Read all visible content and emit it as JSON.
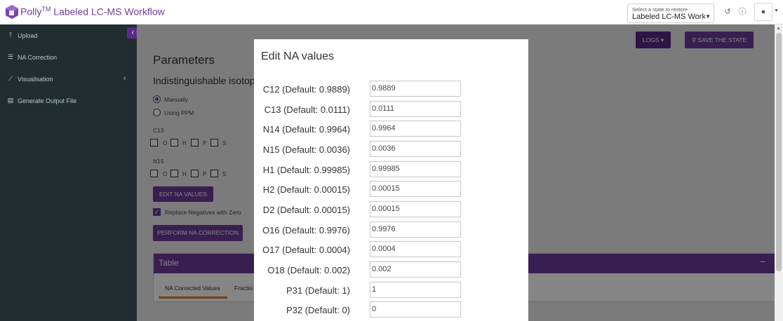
{
  "header": {
    "brand_tm": "TM",
    "app_name_prefix": "Polly",
    "app_name_suffix": "Labeled LC-MS Workflow",
    "state_select_label": "Select a state to restore",
    "state_select_value": "Labeled LC-MS Workflow",
    "brand_color": "#6e3b9c"
  },
  "sidebar": {
    "items": [
      {
        "label": "Upload",
        "icon": "upload-icon"
      },
      {
        "label": "NA Correction",
        "icon": "list-icon"
      },
      {
        "label": "Visualisation",
        "icon": "chart-icon"
      },
      {
        "label": "Generate Output File",
        "icon": "file-icon"
      }
    ]
  },
  "toolbar": {
    "logs_label": "LOGS",
    "save_label": "SAVE THE STATE"
  },
  "params": {
    "title": "Parameters",
    "isotope_heading": "Indistinguishable isotope",
    "radio_manual": "Manually",
    "radio_ppm": "Using PPM",
    "c13_label": "C13",
    "n15_label": "N15",
    "elements": [
      "O",
      "H",
      "P",
      "S"
    ],
    "edit_na_label": "EDIT NA VALUES",
    "replace_negatives_label": "Replace Negatives with Zero",
    "perform_label": "PERFORM NA CORRECTION"
  },
  "table_panel": {
    "title": "Table",
    "minimize": "−",
    "tabs": [
      "NA Corrected Values",
      "Fractio"
    ]
  },
  "modal": {
    "title": "Edit NA values",
    "rows": [
      {
        "label": "C12 (Default: 0.9889)",
        "value": "0.9889"
      },
      {
        "label": "C13 (Default: 0.0111)",
        "value": "0.0111"
      },
      {
        "label": "N14 (Default: 0.9964)",
        "value": "0.9964"
      },
      {
        "label": "N15 (Default: 0.0036)",
        "value": "0.0036"
      },
      {
        "label": "H1 (Default: 0.99985)",
        "value": "0.99985"
      },
      {
        "label": "H2 (Default: 0.00015)",
        "value": "0.00015"
      },
      {
        "label": "D2 (Default: 0.00015)",
        "value": "0.00015"
      },
      {
        "label": "O16 (Default: 0.9976)",
        "value": "0.9976"
      },
      {
        "label": "O17 (Default: 0.0004)",
        "value": "0.0004"
      },
      {
        "label": "O18 (Default: 0.002)",
        "value": "0.002"
      },
      {
        "label": "P31 (Default: 1)",
        "value": "1"
      },
      {
        "label": "P32 (Default: 0)",
        "value": "0"
      }
    ]
  }
}
